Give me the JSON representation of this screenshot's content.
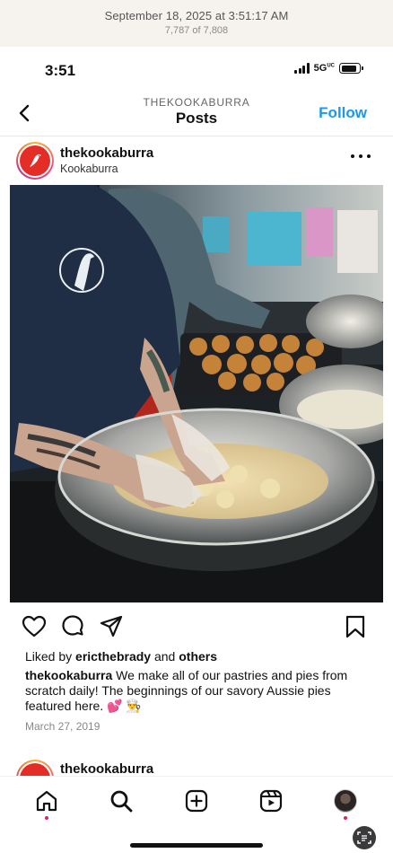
{
  "photos_header": {
    "date": "September 18, 2025 at 3:51:17 AM",
    "count": "7,787 of 7,808"
  },
  "status_bar": {
    "time": "3:51",
    "network": "5G",
    "network_sup": "UC",
    "battery_level": 0.85
  },
  "nav": {
    "username": "THEKOOKABURRA",
    "title": "Posts",
    "follow_label": "Follow",
    "back_icon": "chevron-left-icon"
  },
  "post": {
    "username": "thekookaburra",
    "subtitle": "Kookaburra",
    "more_icon": "more-horizontal-icon",
    "photo_description_icon": "post-photo",
    "liked_by_prefix": "Liked by",
    "liked_by_user": "ericthebrady",
    "liked_by_and": "and",
    "liked_by_others": "others",
    "caption_user": "thekookaburra",
    "caption_text": "We make all of our pastries and pies from scratch daily! The beginnings of our savory Aussie pies featured here. 💕 👨‍🍳",
    "date": "March 27, 2019",
    "actions": {
      "like_icon": "heart-icon",
      "comment_icon": "comment-icon",
      "share_icon": "send-icon",
      "save_icon": "bookmark-icon"
    }
  },
  "next_post": {
    "username": "thekookaburra"
  },
  "tab_bar": {
    "items": [
      "home-icon",
      "search-icon",
      "create-icon",
      "reels-icon",
      "profile-avatar"
    ]
  },
  "colors": {
    "accent": "#2196e8",
    "brand_red": "#e52d27",
    "notification_dot": "#e0245e"
  }
}
